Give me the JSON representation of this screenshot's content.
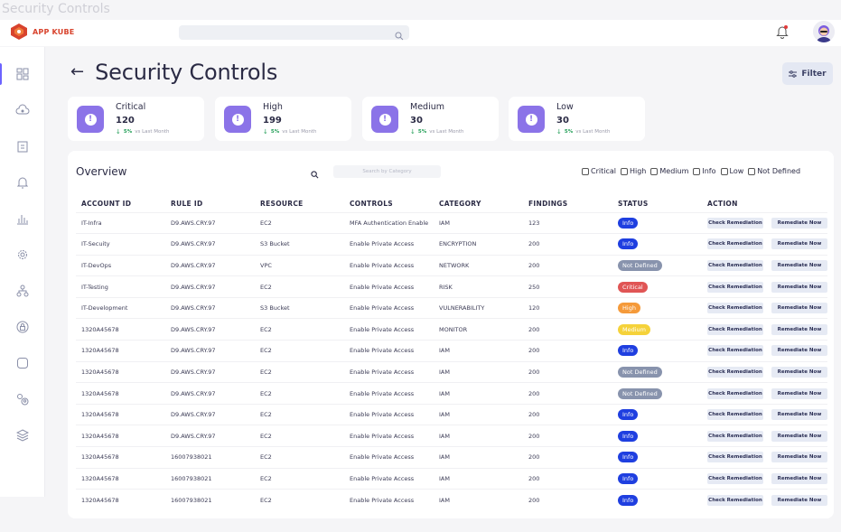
{
  "window": {
    "title": "Security Controls"
  },
  "brand": {
    "name": "APP KUBE",
    "color": "#d8432d"
  },
  "accent": "#8b73e8",
  "header": {
    "title": "Security Controls",
    "filter_label": "Filter"
  },
  "summary_cards": [
    {
      "label": "Critical",
      "value": "120",
      "pct": "5%",
      "note": "vs Last Month"
    },
    {
      "label": "High",
      "value": "199",
      "pct": "5%",
      "note": "vs Last Month"
    },
    {
      "label": "Medium",
      "value": "30",
      "pct": "5%",
      "note": "vs Last Month"
    },
    {
      "label": "Low",
      "value": "30",
      "pct": "5%",
      "note": "vs Last Month"
    }
  ],
  "overview": {
    "title": "Overview",
    "search_placeholder": "Search by Category",
    "filters": [
      "Critical",
      "High",
      "Medium",
      "Info",
      "Low",
      "Not Defined"
    ]
  },
  "table": {
    "columns": [
      "ACCOUNT ID",
      "RULE ID",
      "RESOURCE",
      "CONTROLS",
      "CATEGORY",
      "FINDINGS",
      "STATUS",
      "ACTION"
    ],
    "action_labels": {
      "check": "Check Remediation",
      "remediate": "Remediate Now"
    },
    "status_colors": {
      "Info": "#1f3fe0",
      "Not Defined": "#8893ad",
      "Critical": "#e05555",
      "High": "#f59a3a",
      "Medium": "#f5d23a"
    },
    "rows": [
      [
        "IT-Infra",
        "D9.AWS.CRY.97",
        "EC2",
        "MFA Authentication Enable",
        "IAM",
        "123",
        "Info"
      ],
      [
        "IT-Secuity",
        "D9.AWS.CRY.97",
        "S3 Bucket",
        "Enable Private Access",
        "ENCRYPTION",
        "200",
        "Info"
      ],
      [
        "IT-DevOps",
        "D9.AWS.CRY.97",
        "VPC",
        "Enable Private Access",
        "NETWORK",
        "200",
        "Not Defined"
      ],
      [
        "IT-Testing",
        "D9.AWS.CRY.97",
        "EC2",
        "Enable Private Access",
        "RISK",
        "250",
        "Critical"
      ],
      [
        "IT-Development",
        "D9.AWS.CRY.97",
        "S3 Bucket",
        "Enable Private Access",
        "VULNERABILITY",
        "120",
        "High"
      ],
      [
        "1320A45678",
        "D9.AWS.CRY.97",
        "EC2",
        "Enable Private Access",
        "MONITOR",
        "200",
        "Medium"
      ],
      [
        "1320A45678",
        "D9.AWS.CRY.97",
        "EC2",
        "Enable Private Access",
        "IAM",
        "200",
        "Info"
      ],
      [
        "1320A45678",
        "D9.AWS.CRY.97",
        "EC2",
        "Enable Private Access",
        "IAM",
        "200",
        "Not Defined"
      ],
      [
        "1320A45678",
        "D9.AWS.CRY.97",
        "EC2",
        "Enable Private Access",
        "IAM",
        "200",
        "Not Defined"
      ],
      [
        "1320A45678",
        "D9.AWS.CRY.97",
        "EC2",
        "Enable Private Access",
        "IAM",
        "200",
        "Info"
      ],
      [
        "1320A45678",
        "D9.AWS.CRY.97",
        "EC2",
        "Enable Private Access",
        "IAM",
        "200",
        "Info"
      ],
      [
        "1320A45678",
        "16007938021",
        "EC2",
        "Enable Private Access",
        "IAM",
        "200",
        "Info"
      ],
      [
        "1320A45678",
        "16007938021",
        "EC2",
        "Enable Private Access",
        "IAM",
        "200",
        "Info"
      ],
      [
        "1320A45678",
        "16007938021",
        "EC2",
        "Enable Private Access",
        "IAM",
        "200",
        "Info"
      ]
    ]
  }
}
